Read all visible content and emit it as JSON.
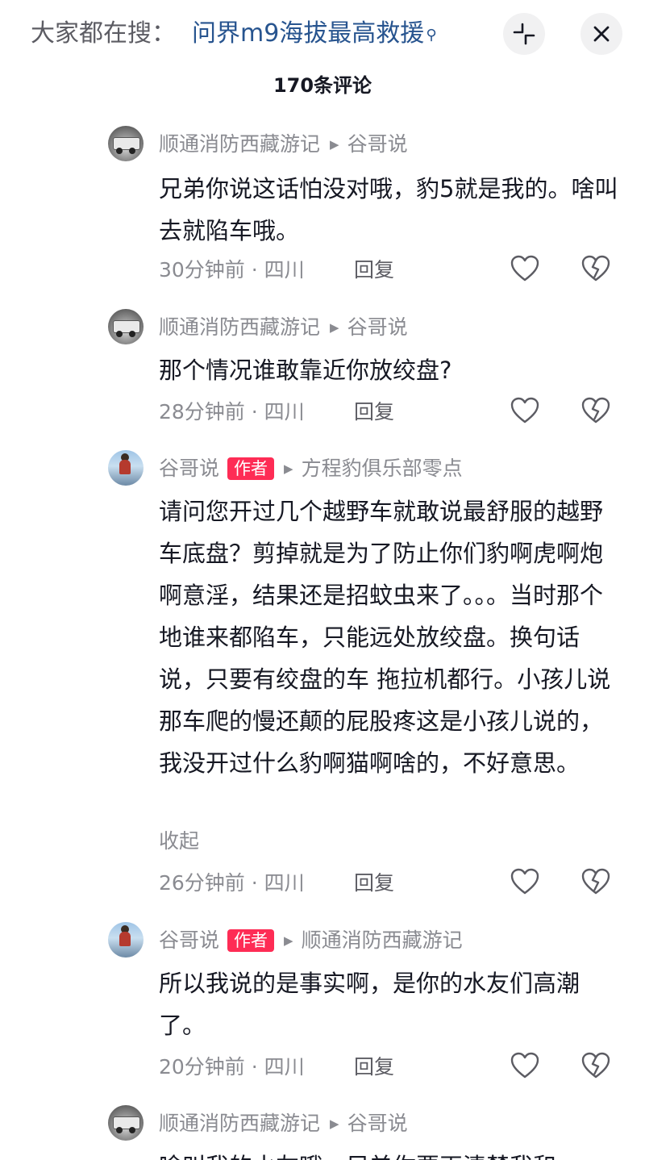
{
  "search": {
    "prefix": "大家都在搜：",
    "query": "问界m9海拔最高救援",
    "query_icon": "search-icon"
  },
  "header": {
    "comment_count": "170条评论"
  },
  "comments": [
    {
      "author": "顺通消防西藏游记",
      "reply_to": "谷哥说",
      "is_author": false,
      "text": "兄弟你说这话怕没对哦，豹5就是我的。啥叫去就陷车哦。",
      "time_location": "30分钟前 · 四川",
      "reply_label": "回复"
    },
    {
      "author": "顺通消防西藏游记",
      "reply_to": "谷哥说",
      "is_author": false,
      "text": "那个情况谁敢靠近你放绞盘?",
      "time_location": "28分钟前 · 四川",
      "reply_label": "回复"
    },
    {
      "author": "谷哥说",
      "author_badge": "作者",
      "reply_to": "方程豹俱乐部零点",
      "is_author": true,
      "text": "请问您开过几个越野车就敢说最舒服的越野车底盘？剪掉就是为了防止你们豹啊虎啊炮啊意淫，结果还是招蚊虫来了。。。当时那个地谁来都陷车，只能远处放绞盘。换句话说，只要有绞盘的车 拖拉机都行。小孩儿说那车爬的慢还颠的屁股疼这是小孩儿说的，我没开过什么豹啊猫啊啥的，不好意思。",
      "collapse_label": "收起",
      "time_location": "26分钟前 · 四川",
      "reply_label": "回复"
    },
    {
      "author": "谷哥说",
      "author_badge": "作者",
      "reply_to": "顺通消防西藏游记",
      "is_author": true,
      "text": "所以我说的是事实啊，是你的水友们高潮了。",
      "time_location": "20分钟前 · 四川",
      "reply_label": "回复"
    },
    {
      "author": "顺通消防西藏游记",
      "reply_to": "谷哥说",
      "is_author": false,
      "text": "啥叫我的水友哦，兄弟你要再清楚我和"
    }
  ],
  "icons": {
    "like": "heart-outline-icon",
    "dislike": "broken-heart-icon",
    "shrink": "collapse-arrows-icon",
    "close": "close-icon"
  },
  "colors": {
    "query": "#27548f",
    "badge": "#fe2c55",
    "meta": "#8a8b91",
    "text": "#161823"
  }
}
